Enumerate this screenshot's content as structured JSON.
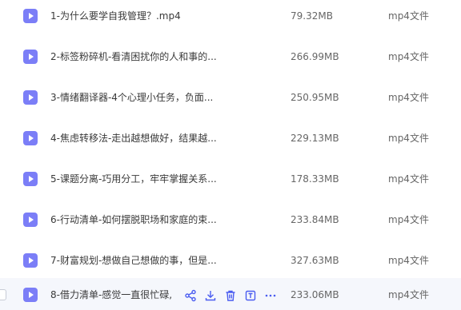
{
  "colors": {
    "accent": "#6f72f5",
    "row_hover": "#f5f7fc"
  },
  "files": [
    {
      "name": "1-为什么要学自我管理？.mp4",
      "size": "79.32MB",
      "type": "mp4文件",
      "icon": "video-file-icon"
    },
    {
      "name": "2-标签粉碎机-看清困扰你的人和事的...",
      "size": "266.99MB",
      "type": "mp4文件",
      "icon": "video-file-icon"
    },
    {
      "name": "3-情绪翻译器-4个心理小任务，负面...",
      "size": "250.95MB",
      "type": "mp4文件",
      "icon": "video-file-icon"
    },
    {
      "name": "4-焦虑转移法-走出越想做好，结果越...",
      "size": "229.13MB",
      "type": "mp4文件",
      "icon": "video-file-icon"
    },
    {
      "name": "5-课题分离-巧用分工，牢牢掌握关系...",
      "size": "178.33MB",
      "type": "mp4文件",
      "icon": "video-file-icon"
    },
    {
      "name": "6-行动清单-如何摆脱职场和家庭的束...",
      "size": "233.84MB",
      "type": "mp4文件",
      "icon": "video-file-icon"
    },
    {
      "name": "7-财富规划-想做自己想做的事，但是...",
      "size": "327.63MB",
      "type": "mp4文件",
      "icon": "video-file-icon"
    },
    {
      "name": "8-借力清单-感觉一直很忙碌,",
      "size": "233.06MB",
      "type": "mp4文件",
      "icon": "video-file-icon"
    }
  ],
  "hover_actions": [
    "share-icon",
    "download-icon",
    "delete-icon",
    "rename-icon",
    "more-icon"
  ]
}
